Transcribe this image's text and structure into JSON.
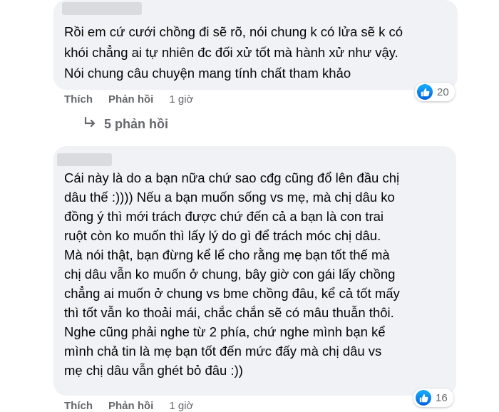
{
  "comments": [
    {
      "lines": [
        "Rồi em cứ cưới chồng đi sẽ rõ, nói chung k có lửa sẽ k có",
        "khói chẳng ai tự nhiên đc đối xử tốt mà hành xử như vậy.",
        "Nói chung câu chuyện mang tính chất tham khảo"
      ],
      "like_label": "Thích",
      "reply_label": "Phản hồi",
      "time": "1 giờ",
      "reaction_count": "20",
      "replies_label": "5 phản hồi"
    },
    {
      "lines": [
        "Cái này là do a bạn nữa chứ sao cđg cũng đổ lên đầu chị",
        "dâu thế :)))) Nếu a bạn muốn sống vs mẹ, mà chị dâu ko",
        "đồng ý thì mới trách được chứ đến cả a bạn là con trai",
        "ruột còn ko muốn thì lấy lý do gì để trách móc chị dâu.",
        "Mà nói thật, bạn đừng kể lể cho rằng mẹ bạn tốt thế mà",
        "chị dâu vẫn ko muốn ở chung, bây giờ con gái lấy chồng",
        "chẳng ai muốn ở chung vs bme chồng đâu, kể cả tốt mấy",
        "thì tốt vẫn ko thoải mái, chắc chắn sẽ có mâu thuẫn thôi.",
        "Nghe cũng phải nghe từ 2 phía, chứ nghe mình bạn kể",
        "mình chả tin là mẹ bạn tốt đến mức đấy mà chị dâu vs",
        "mẹ chị dâu vẫn ghét bỏ đâu :))"
      ],
      "like_label": "Thích",
      "reply_label": "Phản hồi",
      "time": "1 giờ",
      "reaction_count": "16"
    }
  ],
  "icons": {
    "reaction": "like-thumb-icon",
    "replies": "reply-arrow-icon"
  },
  "colors": {
    "bubble": "#f0f2f5",
    "muted_text": "#65676b",
    "like_blue": "#1877f2"
  }
}
